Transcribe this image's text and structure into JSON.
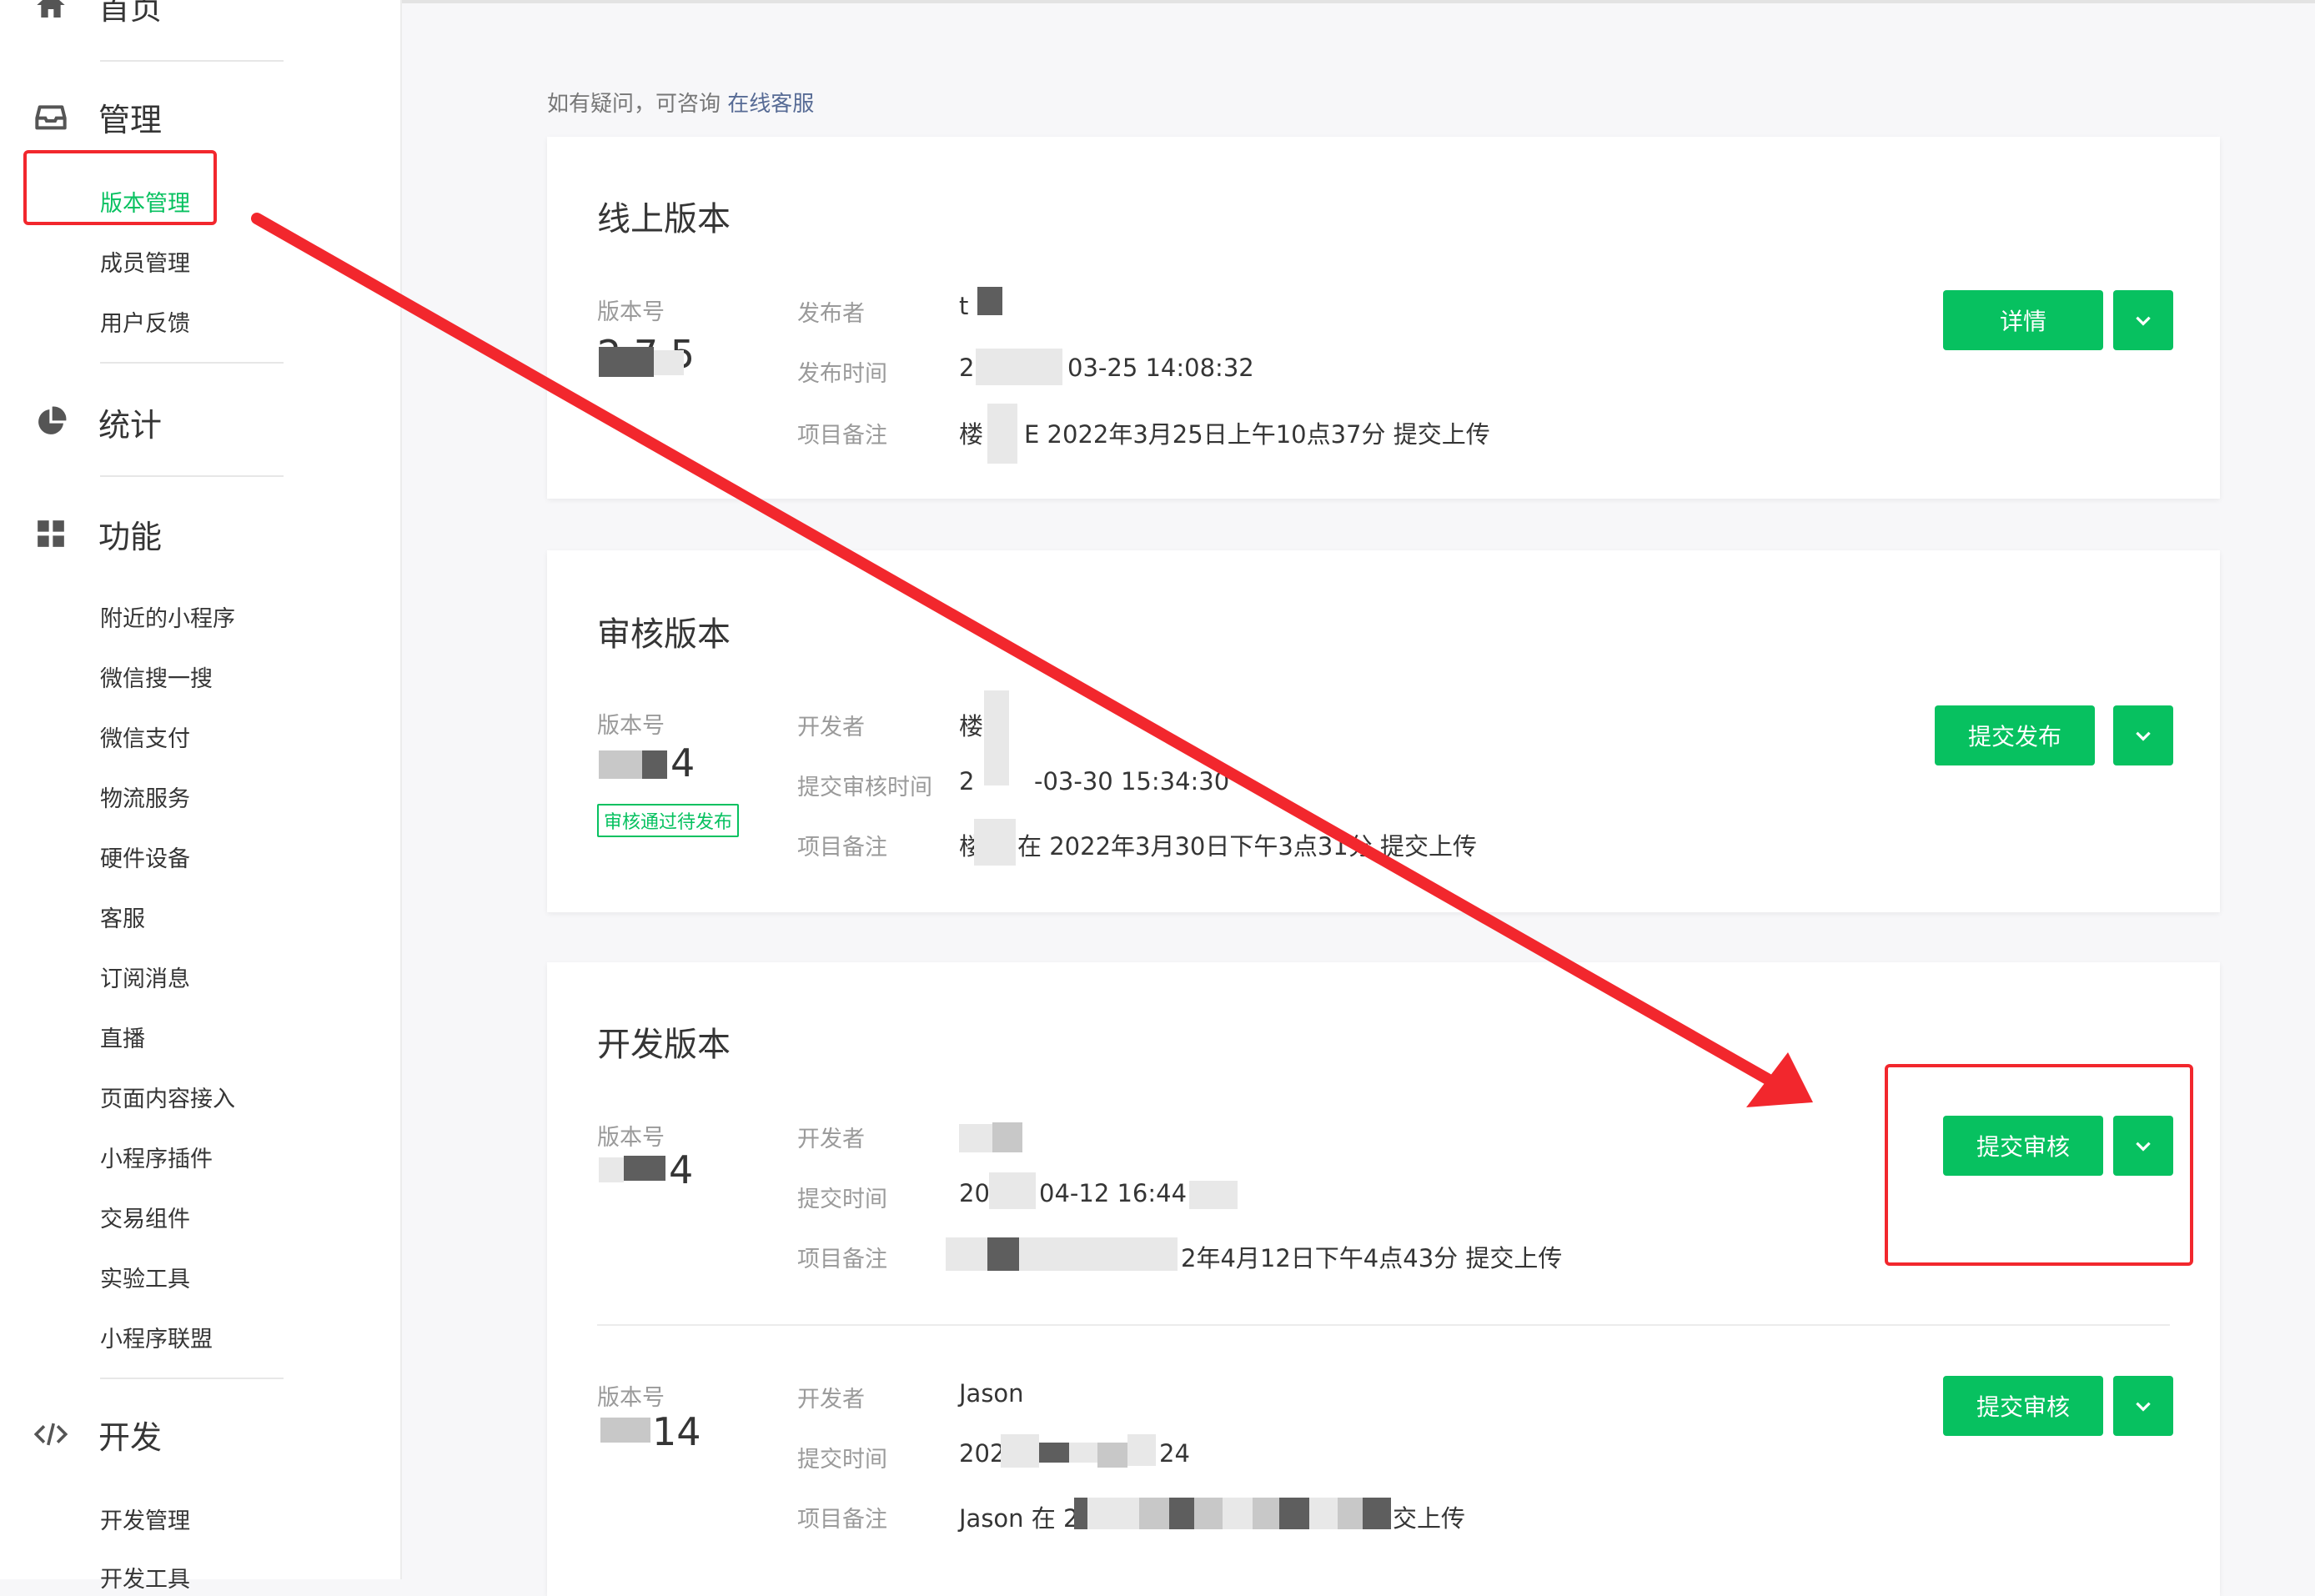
{
  "sidebar": {
    "sections": [
      {
        "label": "首页",
        "icon": "home-icon"
      },
      {
        "label": "管理",
        "icon": "inbox-icon"
      },
      {
        "label": "统计",
        "icon": "pie-chart-icon"
      },
      {
        "label": "功能",
        "icon": "grid-icon"
      },
      {
        "label": "开发",
        "icon": "code-icon"
      }
    ],
    "manage_items": [
      "版本管理",
      "成员管理",
      "用户反馈"
    ],
    "feature_items": [
      "附近的小程序",
      "微信搜一搜",
      "微信支付",
      "物流服务",
      "硬件设备",
      "客服",
      "订阅消息",
      "直播",
      "页面内容接入",
      "小程序插件",
      "交易组件",
      "实验工具",
      "小程序联盟"
    ],
    "dev_items": [
      "开发管理",
      "开发工具"
    ]
  },
  "main": {
    "hint": "如有疑问，可咨询",
    "hint_link": "在线客服",
    "online": {
      "title": "线上版本",
      "version_label": "版本号",
      "version_value": "2.7.5",
      "publisher_label": "发布者",
      "publisher_value": "t",
      "time_label": "发布时间",
      "time_prefix": "2",
      "time_value": "03-25 14:08:32",
      "note_label": "项目备注",
      "note_prefix": "楼",
      "note_value": "E 2022年3月25日上午10点37分 提交上传",
      "button": "详情"
    },
    "review": {
      "title": "审核版本",
      "version_label": "版本号",
      "version_value": "4",
      "badge": "审核通过待发布",
      "dev_label": "开发者",
      "dev_value": "楼",
      "time_label": "提交审核时间",
      "time_prefix": "2",
      "time_value": "-03-30 15:34:30",
      "note_label": "项目备注",
      "note_prefix": "楼",
      "note_value": "在 2022年3月30日下午3点31分 提交上传",
      "button": "提交发布"
    },
    "dev": {
      "title": "开发版本",
      "item1": {
        "version_label": "版本号",
        "version_value": "4",
        "dev_label": "开发者",
        "time_label": "提交时间",
        "time_prefix": "20",
        "time_value": "04-12 16:44:0",
        "note_label": "项目备注",
        "note_value": "2年4月12日下午4点43分 提交上传",
        "button": "提交审核"
      },
      "item2": {
        "version_label": "版本号",
        "version_value": "14",
        "dev_label": "开发者",
        "dev_value": "Jason",
        "time_label": "提交时间",
        "time_prefix": "202",
        "time_suffix": "24",
        "note_label": "项目备注",
        "note_prefix": "Jason 在 2",
        "note_suffix": "交上传",
        "button": "提交审核"
      }
    }
  },
  "colors": {
    "accent": "#07c160",
    "annotation": "#f2272d",
    "link": "#576b95"
  }
}
